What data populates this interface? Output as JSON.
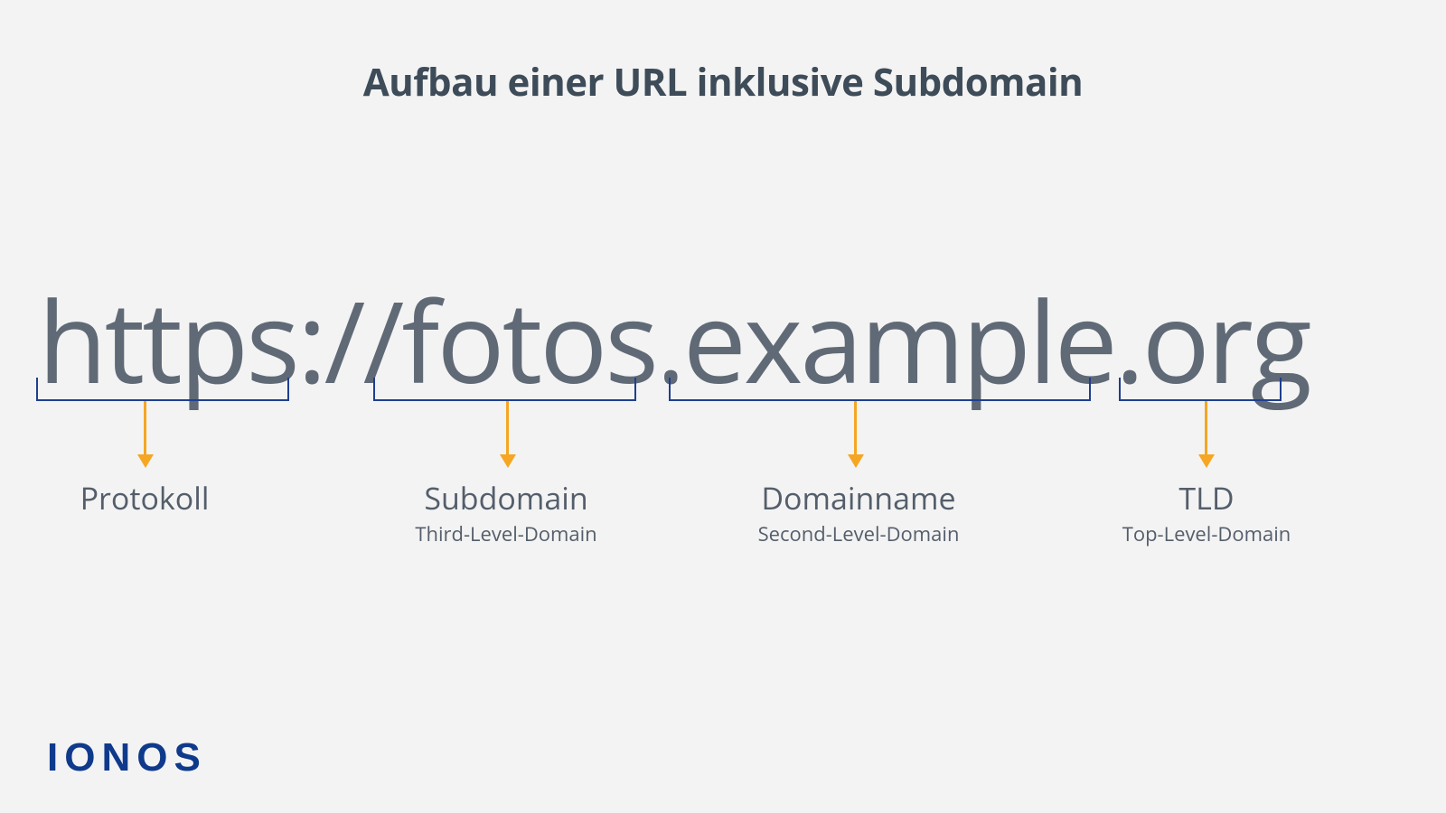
{
  "title": "Aufbau einer URL inklusive Subdomain",
  "url_text": "https://fotos.example.org",
  "parts": {
    "protocol": {
      "label": "Protokoll",
      "sublabel": ""
    },
    "subdomain": {
      "label": "Subdomain",
      "sublabel": "Third-Level-Domain"
    },
    "domainname": {
      "label": "Domainname",
      "sublabel": "Second-Level-Domain"
    },
    "tld": {
      "label": "TLD",
      "sublabel": "Top-Level-Domain"
    }
  },
  "brand": "IONOS",
  "colors": {
    "bracket": "#1f3f8f",
    "arrow": "#f5a623",
    "text": "#606a76",
    "title": "#3e4c59",
    "brand": "#0f3a8c"
  }
}
